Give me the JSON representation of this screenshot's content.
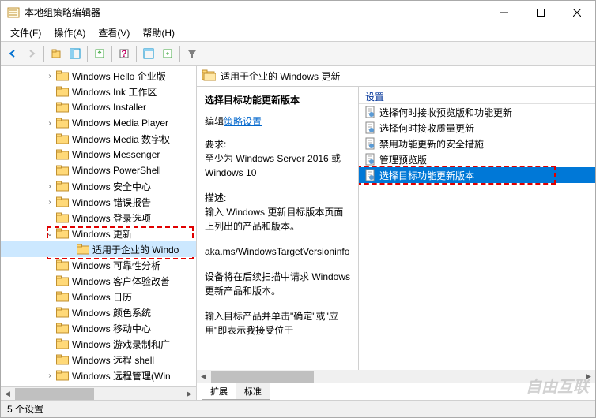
{
  "window": {
    "title": "本地组策略编辑器"
  },
  "menu": {
    "file": "文件(F)",
    "action": "操作(A)",
    "view": "查看(V)",
    "help": "帮助(H)"
  },
  "tree": {
    "items": [
      {
        "label": "Windows Hello 企业版",
        "expandable": true
      },
      {
        "label": "Windows Ink 工作区",
        "expandable": false
      },
      {
        "label": "Windows Installer",
        "expandable": false
      },
      {
        "label": "Windows Media Player",
        "expandable": true
      },
      {
        "label": "Windows Media 数字权",
        "expandable": false
      },
      {
        "label": "Windows Messenger",
        "expandable": false
      },
      {
        "label": "Windows PowerShell",
        "expandable": false
      },
      {
        "label": "Windows 安全中心",
        "expandable": true
      },
      {
        "label": "Windows 错误报告",
        "expandable": true
      },
      {
        "label": "Windows 登录选项",
        "expandable": false
      },
      {
        "label": "Windows 更新",
        "expandable": true,
        "expanded": true
      },
      {
        "label": "适用于企业的 Windo",
        "child": true,
        "selected": true
      },
      {
        "label": "Windows 可靠性分析",
        "expandable": false
      },
      {
        "label": "Windows 客户体验改善",
        "expandable": false
      },
      {
        "label": "Windows 日历",
        "expandable": false
      },
      {
        "label": "Windows 颜色系统",
        "expandable": false
      },
      {
        "label": "Windows 移动中心",
        "expandable": false
      },
      {
        "label": "Windows 游戏录制和广",
        "expandable": false
      },
      {
        "label": "Windows 远程 shell",
        "expandable": false
      },
      {
        "label": "Windows 远程管理(Win",
        "expandable": true
      }
    ]
  },
  "header": {
    "title": "适用于企业的 Windows 更新"
  },
  "description": {
    "title": "选择目标功能更新版本",
    "edit_prefix": "编辑",
    "edit_link": "策略设置",
    "req_label": "要求:",
    "req_text": "至少为 Windows Server 2016 或 Windows 10",
    "desc_label": "描述:",
    "desc_text1": "输入 Windows 更新目标版本页面上列出的产品和版本。",
    "desc_text2": "aka.ms/WindowsTargetVersioninfo",
    "desc_text3": "设备将在后续扫描中请求 Windows 更新产品和版本。",
    "desc_text4": "输入目标产品并单击\"确定\"或\"应用\"即表示我接受位于"
  },
  "settings": {
    "header": "设置",
    "items": [
      {
        "label": "选择何时接收预览版和功能更新"
      },
      {
        "label": "选择何时接收质量更新"
      },
      {
        "label": "禁用功能更新的安全措施"
      },
      {
        "label": "管理预览版"
      },
      {
        "label": "选择目标功能更新版本",
        "selected": true
      }
    ]
  },
  "tabs": {
    "extended": "扩展",
    "standard": "标准"
  },
  "statusbar": {
    "text": "5 个设置"
  },
  "watermark": "自由互联"
}
